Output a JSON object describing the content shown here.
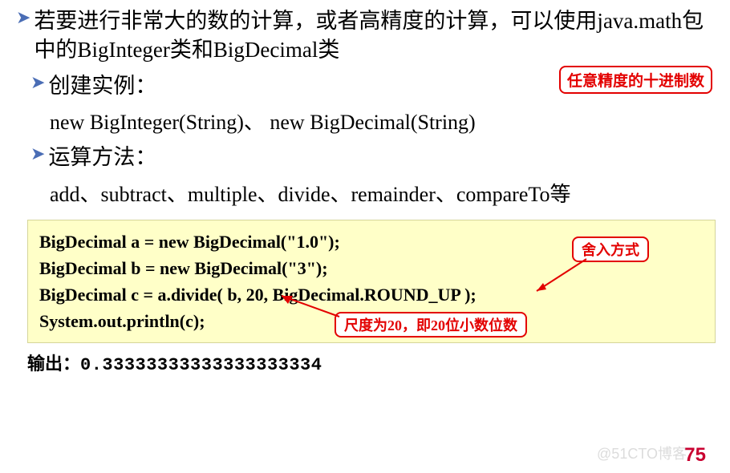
{
  "line1": "若要进行非常大的数的计算，或者高精度的计算，可以使用java.math包中的BigInteger类和BigDecimal类",
  "bullet2": "创建实例：",
  "line2_indent": "new BigInteger(String)、 new BigDecimal(String)",
  "bullet3": "运算方法：",
  "line3_indent": "add、subtract、multiple、divide、remainder、compareTo等",
  "callout1": "任意精度的十进制数",
  "code": {
    "l1": "BigDecimal a = new BigDecimal(\"1.0\");",
    "l2": "BigDecimal b = new BigDecimal(\"3\");",
    "l3": "BigDecimal c = a.divide( b,  20,  BigDecimal.ROUND_UP );",
    "l4": "System.out.println(c);"
  },
  "callout2": "舍入方式",
  "callout3": "尺度为20，即20位小数位数",
  "output_label": "输出：",
  "output_val": "0.33333333333333333334",
  "page_num": "75",
  "watermark": "@51CTO博客"
}
